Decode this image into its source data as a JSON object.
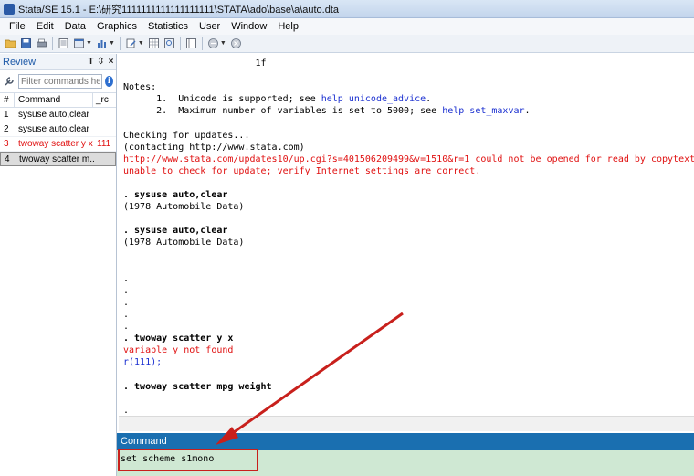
{
  "window": {
    "title": "Stata/SE 15.1 - E:\\研究1111111111111111111\\STATA\\ado\\base\\a\\auto.dta"
  },
  "menu": [
    "File",
    "Edit",
    "Data",
    "Graphics",
    "Statistics",
    "User",
    "Window",
    "Help"
  ],
  "review": {
    "title": "Review",
    "header_buttons": [
      "T",
      "⇳",
      "×"
    ],
    "filter_placeholder": "Filter commands he",
    "columns": {
      "num": "#",
      "command": "Command",
      "rc": "_rc"
    },
    "rows": [
      {
        "num": "1",
        "command": "sysuse auto,clear",
        "rc": ""
      },
      {
        "num": "2",
        "command": "sysuse auto,clear",
        "rc": ""
      },
      {
        "num": "3",
        "command": "twoway scatter y x",
        "rc": "111"
      },
      {
        "num": "4",
        "command": "twoway scatter m...",
        "rc": ""
      }
    ]
  },
  "results": {
    "l01": "                        1f",
    "l02": "",
    "l03": "Notes:",
    "l04a": "      1.  Unicode is supported; see ",
    "l04b": "help unicode_advice",
    "l04c": ".",
    "l05a": "      2.  Maximum number of variables is set to 5000; see ",
    "l05b": "help set_maxvar",
    "l05c": ".",
    "l06": "",
    "l07": "Checking for updates...",
    "l08": "(contacting http://www.stata.com)",
    "l09": "http://www.stata.com/updates10/up.cgi?s=401506209499&v=1510&r=1 could not be opened for read by copytextfil",
    "l10": "unable to check for update; verify Internet settings are correct.",
    "l11": "",
    "l12": ". sysuse auto,clear",
    "l13": "(1978 Automobile Data)",
    "l14": "",
    "l15": ". sysuse auto,clear",
    "l16": "(1978 Automobile Data)",
    "l17": "",
    "l18": "",
    "l19": ".",
    "l20": ".",
    "l21": ".",
    "l22": ".",
    "l23": ".",
    "l24": ". twoway scatter y x",
    "l25": "variable y not found",
    "l26": "r(111);",
    "l27": "",
    "l28": ". twoway scatter mpg weight",
    "l29": "",
    "l30": "."
  },
  "command": {
    "title": "Command",
    "value": "set scheme s1mono"
  },
  "colors": {
    "accent": "#1a6fb0",
    "error": "#e01010",
    "link": "#1a2fd0",
    "command_bg": "#cfe8d3",
    "annotation": "#c8201c"
  }
}
